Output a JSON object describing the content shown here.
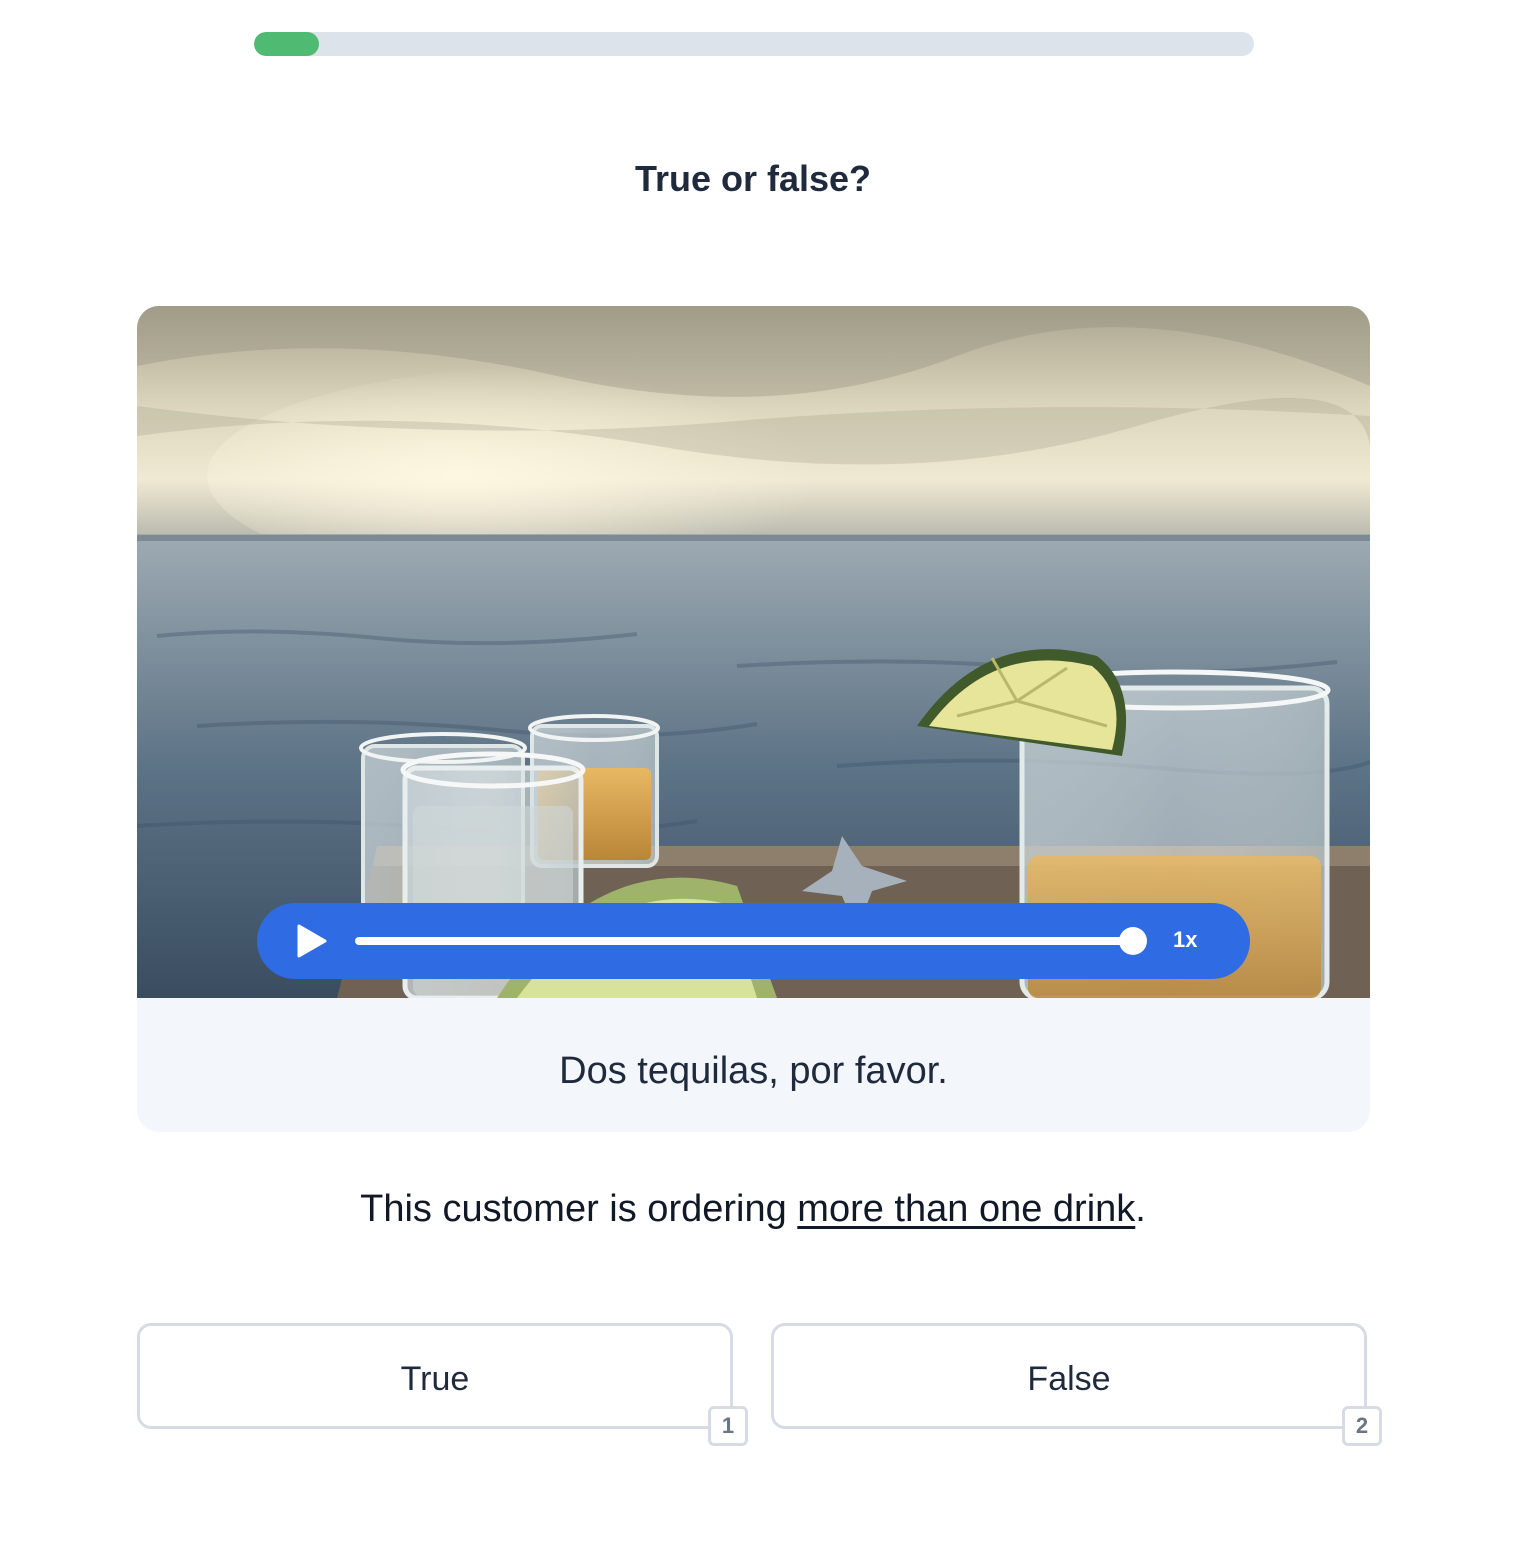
{
  "progress": {
    "fraction": 0.065,
    "color": "#4fba72"
  },
  "prompt": {
    "title": "True or false?"
  },
  "media": {
    "image_description": "sunset-sea-tequila-shots",
    "audio": {
      "play_icon": "play-icon",
      "position_fraction": 1.0,
      "speed": "1x",
      "color": "#2f6be3"
    },
    "caption": "Dos tequilas, por favor."
  },
  "statement": {
    "before": "This customer is ordering ",
    "emphasis": "more than one drink",
    "after": "."
  },
  "options": [
    {
      "label": "True",
      "key": "1"
    },
    {
      "label": "False",
      "key": "2"
    }
  ]
}
